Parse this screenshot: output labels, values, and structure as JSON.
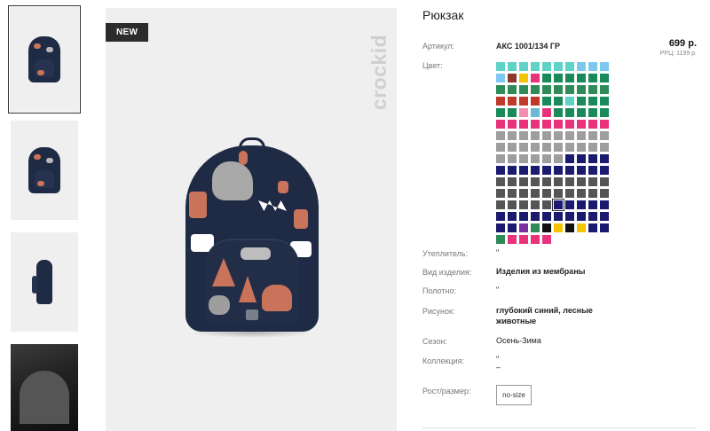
{
  "badge": "NEW",
  "brand": "crockid",
  "product": {
    "title": "Рюкзак",
    "price": "699 р.",
    "rrp": "РРЦ: 1199 р."
  },
  "attributes": {
    "article_label": "Артикул:",
    "article_value": "АКС 1001/134 ГР",
    "color_label": "Цвет:",
    "insulation_label": "Утеплитель:",
    "insulation_value": "\"",
    "type_label": "Вид изделия:",
    "type_value": "Изделия из мембраны",
    "fabric_label": "Полотно:",
    "fabric_value": "\"",
    "pattern_label": "Рисунок:",
    "pattern_value_line1": "глубокий синий, лесные",
    "pattern_value_line2": "животные",
    "season_label": "Сезон:",
    "season_value": "Осень-Зима",
    "collection_label": "Коллекция:",
    "collection_value_line1": "\"",
    "collection_value_line2": "–",
    "size_label": "Рост/размер:",
    "size_value": "no-size"
  },
  "thumbnails": [
    {
      "name": "thumb-front",
      "active": true
    },
    {
      "name": "thumb-back",
      "active": false
    },
    {
      "name": "thumb-side",
      "active": false
    },
    {
      "name": "thumb-open",
      "active": false
    }
  ],
  "swatch_colors": [
    [
      "#5fd3c7",
      "#5fd3c7",
      "#5fd3c7",
      "#5fd3c7",
      "#5fd3c7",
      "#5fd3c7",
      "#5fd3c7",
      "#7ec8f0",
      "#7ec8f0",
      "#7ec8f0"
    ],
    [
      "#7ec8f0",
      "#8b3a2a",
      "#f5c400",
      "#e8327c",
      "#1a8a5a",
      "#1a8a5a",
      "#1a8a5a",
      "#1a8a5a",
      "#1a8a5a",
      "#1a8a5a"
    ],
    [
      "#2e8b57",
      "#2e8b57",
      "#2e8b57",
      "#2e8b57",
      "#2e8b57",
      "#2e8b57",
      "#2e8b57",
      "#2e8b57",
      "#2e8b57",
      "#2e8b57"
    ],
    [
      "#c0392b",
      "#c0392b",
      "#c0392b",
      "#c0392b",
      "#1a8a5a",
      "#1a8a5a",
      "#5fd3c7",
      "#1a8a5a",
      "#1a8a5a",
      "#1a8a5a"
    ],
    [
      "#1a8a5a",
      "#1a8a5a",
      "#f08fb0",
      "#6fb7d6",
      "#e8327c",
      "#1a8a5a",
      "#1a8a5a",
      "#1a8a5a",
      "#1a8a5a",
      "#1a8a5a"
    ],
    [
      "#e8327c",
      "#e8327c",
      "#e8327c",
      "#e8327c",
      "#e8327c",
      "#e8327c",
      "#e8327c",
      "#e8327c",
      "#e8327c",
      "#e8327c"
    ],
    [
      "#9e9e9e",
      "#9e9e9e",
      "#9e9e9e",
      "#9e9e9e",
      "#9e9e9e",
      "#9e9e9e",
      "#9e9e9e",
      "#9e9e9e",
      "#9e9e9e",
      "#9e9e9e"
    ],
    [
      "#9e9e9e",
      "#9e9e9e",
      "#9e9e9e",
      "#9e9e9e",
      "#9e9e9e",
      "#9e9e9e",
      "#9e9e9e",
      "#9e9e9e",
      "#9e9e9e",
      "#9e9e9e"
    ],
    [
      "#9e9e9e",
      "#9e9e9e",
      "#9e9e9e",
      "#9e9e9e",
      "#9e9e9e",
      "#9e9e9e",
      "#1a1a6e",
      "#1a1a6e",
      "#1a1a6e",
      "#1a1a6e"
    ],
    [
      "#1a1a6e",
      "#1a1a6e",
      "#1a1a6e",
      "#1a1a6e",
      "#1a1a6e",
      "#1a1a6e",
      "#1a1a6e",
      "#1a1a6e",
      "#1a1a6e",
      "#1a1a6e"
    ],
    [
      "#555555",
      "#555555",
      "#555555",
      "#555555",
      "#555555",
      "#555555",
      "#555555",
      "#555555",
      "#555555",
      "#555555"
    ],
    [
      "#555555",
      "#555555",
      "#555555",
      "#555555",
      "#555555",
      "#555555",
      "#555555",
      "#555555",
      "#555555",
      "#555555"
    ],
    [
      "#555555",
      "#555555",
      "#555555",
      "#555555",
      "#555555",
      "#1a1a6e",
      "#1a1a6e",
      "#1a1a6e",
      "#1a1a6e",
      "#1a1a6e"
    ],
    [
      "#1a1a6e",
      "#1a1a6e",
      "#1a1a6e",
      "#1a1a6e",
      "#1a1a6e",
      "#1a1a6e",
      "#1a1a6e",
      "#1a1a6e",
      "#1a1a6e",
      "#1a1a6e"
    ],
    [
      "#1a1a6e",
      "#1a1a6e",
      "#7b2fa0",
      "#2e8b57",
      "#111111",
      "#f5c400",
      "#111111",
      "#f5c400",
      "#1a1a6e",
      "#1a1a6e"
    ],
    [
      "#2e8b57",
      "#e8327c",
      "#e8327c",
      "#e8327c",
      "#e8327c"
    ]
  ],
  "selected_swatch": {
    "row": 12,
    "col": 5
  }
}
